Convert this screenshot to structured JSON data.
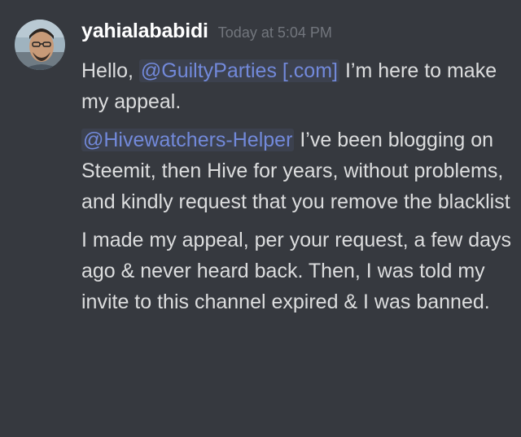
{
  "message": {
    "author": {
      "username": "yahialababidi",
      "avatar_icon": "user-avatar-photo"
    },
    "timestamp": "Today at 5:04 PM",
    "lines": {
      "first": {
        "before": "Hello,",
        "mention": "@GuiltyParties [.com]",
        "after": "I’m here to make my appeal."
      },
      "second": {
        "mention": "@Hivewatchers-Helper",
        "after": "I’ve been blogging on Steemit, then Hive for years, without problems, and kindly request that you remove the blacklist"
      },
      "third": {
        "text": "I made my appeal, per your request, a few days ago & never heard back. Then, I was told my invite to this channel expired & I was banned."
      }
    }
  },
  "colors": {
    "background": "#36393f",
    "username": "#ffffff",
    "timestamp": "#72767d",
    "text": "#dcddde",
    "mention": "#7289da"
  }
}
